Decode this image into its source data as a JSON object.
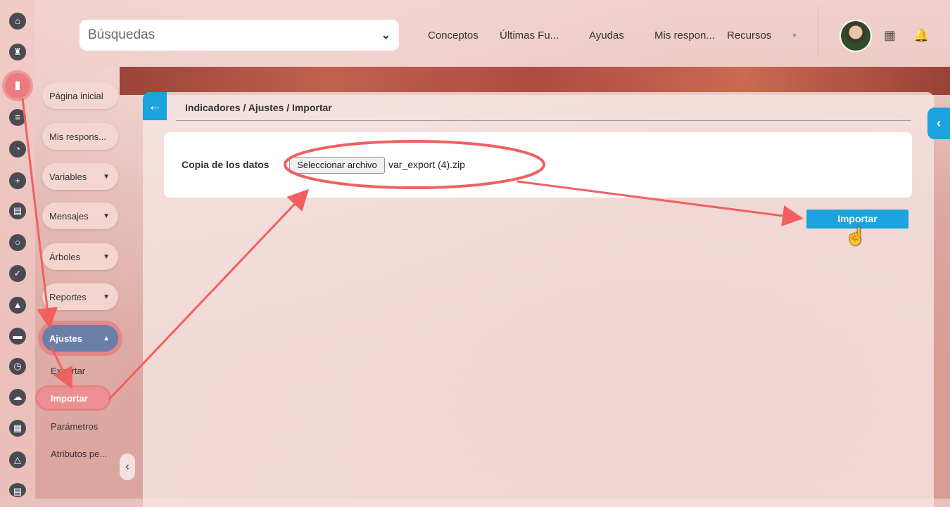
{
  "search": {
    "label": "Búsquedas"
  },
  "top_nav": {
    "items": [
      "Conceptos",
      "Últimas Fu...",
      "Ayudas",
      "Mis respon...",
      "Recursos"
    ]
  },
  "left_menu": {
    "buttons": [
      "Página inicial",
      "Mis respons...",
      "Variables",
      "Mensajes",
      "Árboles",
      "Reportes",
      "Ajustes"
    ],
    "submenu": [
      "Exportar",
      "Importar",
      "Parámetros",
      "Atributos pe..."
    ]
  },
  "breadcrumb": "Indicadores / Ajustes / Importar",
  "form": {
    "label": "Copia de los datos",
    "file_button": "Seleccionar archivo",
    "file_name": "var_export (4).zip"
  },
  "import_button": "Importar",
  "colors": {
    "accent": "#1aa3dc",
    "annotation": "#f06060",
    "active_menu": "#6a7fa8"
  }
}
